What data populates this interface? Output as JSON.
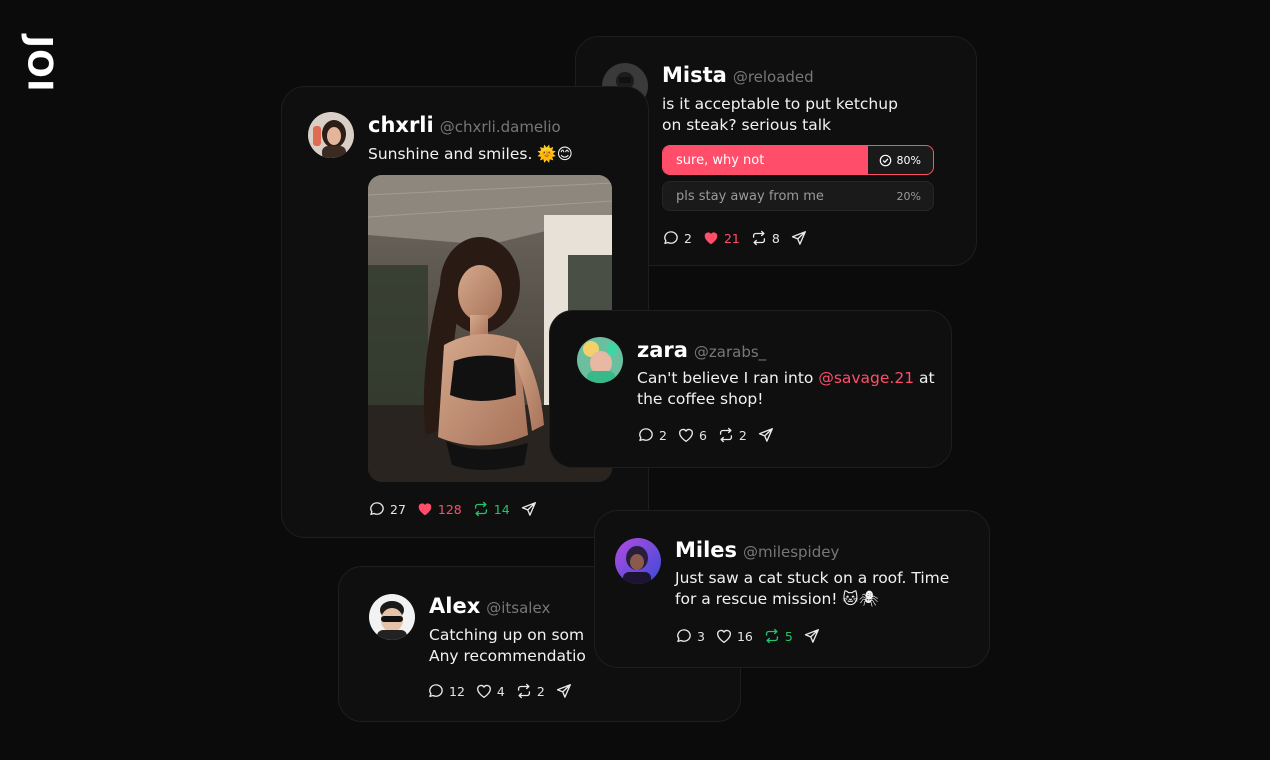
{
  "brand": {
    "logo": "JOI"
  },
  "colors": {
    "accent": "#ff4d6a",
    "repost": "#21c46a",
    "bg": "#0b0b0b"
  },
  "posts": {
    "mista": {
      "name": "Mista",
      "handle": "@reloaded",
      "text_line1": "is it acceptable to put ketchup",
      "text_line2": "on steak? serious talk",
      "poll": [
        {
          "label": "sure, why not",
          "percent": "80%",
          "value": 0.8,
          "selected": true
        },
        {
          "label": "pls stay away from me",
          "percent": "20%",
          "value": 0.2,
          "selected": false
        }
      ],
      "comments": "2",
      "likes": "21",
      "reposts": "8",
      "liked": true,
      "reposted": false
    },
    "chxrli": {
      "name": "chxrli",
      "handle": "@chxrli.damelio",
      "text": "Sunshine and smiles. 🌞😊",
      "comments": "27",
      "likes": "128",
      "reposts": "14",
      "liked": true,
      "reposted": true
    },
    "zara": {
      "name": "zara",
      "handle": "@zarabs_",
      "text_pre": "Can't believe I ran into ",
      "mention": "@savage.21",
      "text_post": " at",
      "text_line2": "the coffee shop!",
      "comments": "2",
      "likes": "6",
      "reposts": "2",
      "liked": false,
      "reposted": false
    },
    "miles": {
      "name": "Miles",
      "handle": "@milespidey",
      "text_line1": "Just saw a cat stuck on a roof. Time",
      "text_line2": "for a rescue mission! 🐱🕷",
      "comments": "3",
      "likes": "16",
      "reposts": "5",
      "liked": false,
      "reposted": true
    },
    "alex": {
      "name": "Alex",
      "handle": "@itsalex",
      "text_line1": "Catching up on som",
      "text_line2": "Any recommendatio",
      "comments": "12",
      "likes": "4",
      "reposts": "2",
      "liked": false,
      "reposted": false
    }
  }
}
